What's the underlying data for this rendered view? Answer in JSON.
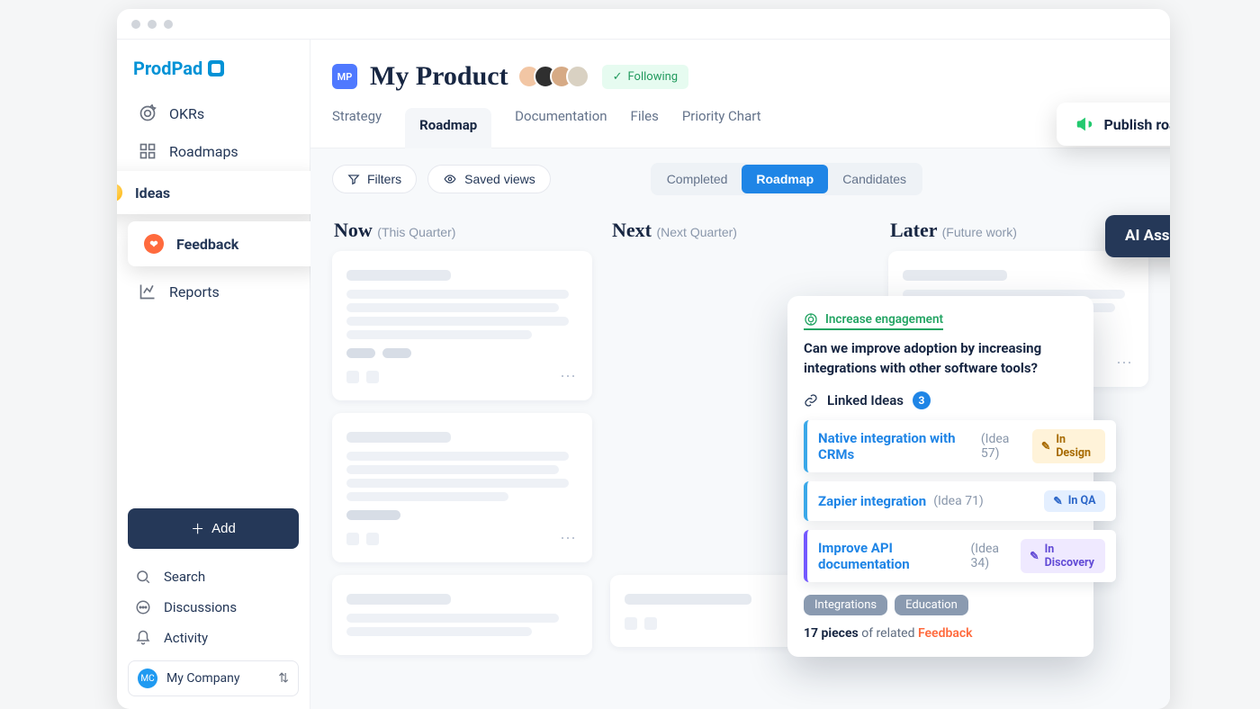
{
  "brand": "ProdPad",
  "sidebar": {
    "nav": [
      {
        "label": "OKRs"
      },
      {
        "label": "Roadmaps"
      },
      {
        "label": "Ideas"
      },
      {
        "label": "Feedback"
      },
      {
        "label": "Reports"
      }
    ],
    "add": "Add",
    "utilities": [
      {
        "label": "Search"
      },
      {
        "label": "Discussions"
      },
      {
        "label": "Activity"
      }
    ],
    "company": {
      "initials": "MC",
      "name": "My Company"
    }
  },
  "header": {
    "product_initials": "MP",
    "title": "My Product",
    "following": "Following"
  },
  "tabs": [
    "Strategy",
    "Roadmap",
    "Documentation",
    "Files",
    "Priority Chart"
  ],
  "active_tab": 1,
  "toolbar": {
    "filters": "Filters",
    "saved_views": "Saved views",
    "segments": [
      "Completed",
      "Roadmap",
      "Candidates"
    ],
    "active_segment": 1
  },
  "columns": [
    {
      "title": "Now",
      "sub": "(This Quarter)"
    },
    {
      "title": "Next",
      "sub": "(Next Quarter)"
    },
    {
      "title": "Later",
      "sub": "(Future work)"
    }
  ],
  "feature_card": {
    "okr": "Increase engagement",
    "question": "Can we improve adoption by increasing integrations with other software tools?",
    "linked_label": "Linked Ideas",
    "linked_count": "3",
    "ideas": [
      {
        "name": "Native integration with CRMs",
        "ref": "(Idea 57)",
        "status": "In Design",
        "status_class": "st-design",
        "border": "#3aa8e8"
      },
      {
        "name": "Zapier integration",
        "ref": "(Idea 71)",
        "status": "In QA",
        "status_class": "st-qa",
        "border": "#3aa8e8"
      },
      {
        "name": "Improve API documentation",
        "ref": "(Idea 34)",
        "status": "In Discovery",
        "status_class": "st-disc",
        "border": "#7458ff"
      }
    ],
    "tags": [
      "Integrations",
      "Education"
    ],
    "related_count": "17 pieces",
    "related_mid": " of related ",
    "related_link": "Feedback"
  },
  "publish_label": "Publish roadmap",
  "ai_label": "AI Assistant"
}
